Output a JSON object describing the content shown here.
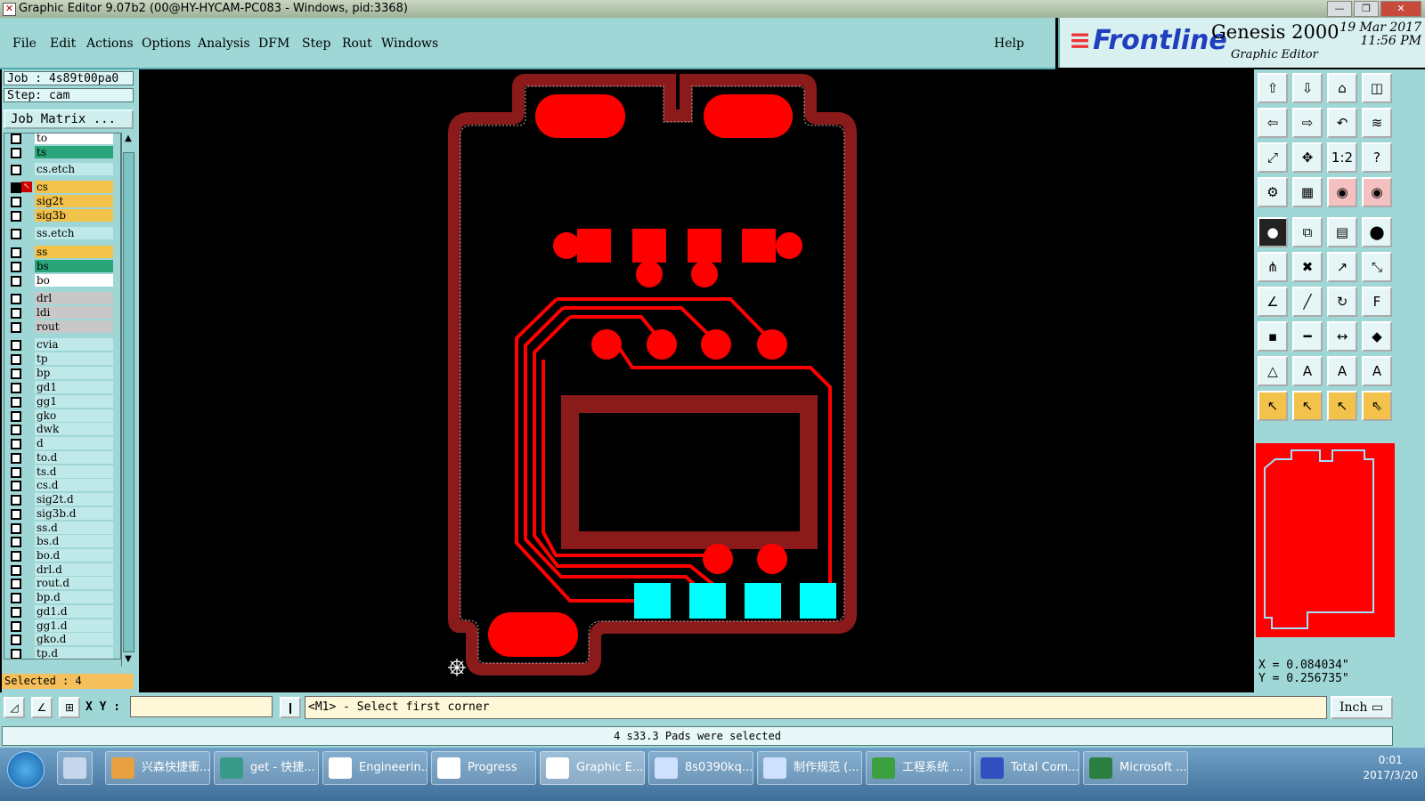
{
  "window": {
    "title": "Graphic Editor 9.07b2 (00@HY-HYCAM-PC083 - Windows, pid:3368)"
  },
  "menu": {
    "file": "File",
    "edit": "Edit",
    "actions": "Actions",
    "options": "Options",
    "analysis": "Analysis",
    "dfm": "DFM",
    "step": "Step",
    "rout": "Rout",
    "windows": "Windows",
    "help": "Help"
  },
  "brand": {
    "logo": "Frontline",
    "product": "Genesis 2000",
    "subtitle": "Graphic Editor",
    "date": "19 Mar 2017",
    "time": "11:56 PM"
  },
  "job": {
    "job_label": "Job : 4s89t00pa0",
    "step_label": "Step: cam",
    "matrix_button": "Job Matrix ..."
  },
  "layers": [
    {
      "name": "to",
      "color": "#ffffff"
    },
    {
      "name": "ts",
      "color": "#2aa57a"
    },
    {
      "name": "cs.etch",
      "color": "#bfe8e8"
    },
    {
      "name": "cs",
      "color": "#f3c24a"
    },
    {
      "name": "sig2t",
      "color": "#f3c24a"
    },
    {
      "name": "sig3b",
      "color": "#f3c24a"
    },
    {
      "name": "ss.etch",
      "color": "#bfe8e8"
    },
    {
      "name": "ss",
      "color": "#f3c24a"
    },
    {
      "name": "bs",
      "color": "#2aa57a"
    },
    {
      "name": "bo",
      "color": "#ffffff"
    },
    {
      "name": "drl",
      "color": "#c8c8c8"
    },
    {
      "name": "ldi",
      "color": "#c8c8c8"
    },
    {
      "name": "rout",
      "color": "#c8c8c8"
    },
    {
      "name": "cvia",
      "color": "#bfe8e8"
    },
    {
      "name": "tp",
      "color": "#bfe8e8"
    },
    {
      "name": "bp",
      "color": "#bfe8e8"
    },
    {
      "name": "gd1",
      "color": "#bfe8e8"
    },
    {
      "name": "gg1",
      "color": "#bfe8e8"
    },
    {
      "name": "gko",
      "color": "#bfe8e8"
    },
    {
      "name": "dwk",
      "color": "#bfe8e8"
    },
    {
      "name": "d",
      "color": "#bfe8e8"
    },
    {
      "name": "to.d",
      "color": "#bfe8e8"
    },
    {
      "name": "ts.d",
      "color": "#bfe8e8"
    },
    {
      "name": "cs.d",
      "color": "#bfe8e8"
    },
    {
      "name": "sig2t.d",
      "color": "#bfe8e8"
    },
    {
      "name": "sig3b.d",
      "color": "#bfe8e8"
    },
    {
      "name": "ss.d",
      "color": "#bfe8e8"
    },
    {
      "name": "bs.d",
      "color": "#bfe8e8"
    },
    {
      "name": "bo.d",
      "color": "#bfe8e8"
    },
    {
      "name": "drl.d",
      "color": "#bfe8e8"
    },
    {
      "name": "rout.d",
      "color": "#bfe8e8"
    },
    {
      "name": "bp.d",
      "color": "#bfe8e8"
    },
    {
      "name": "gd1.d",
      "color": "#bfe8e8"
    },
    {
      "name": "gg1.d",
      "color": "#bfe8e8"
    },
    {
      "name": "gko.d",
      "color": "#bfe8e8"
    },
    {
      "name": "tp.d",
      "color": "#bfe8e8"
    }
  ],
  "selected_label": "Selected : 4",
  "coords": {
    "x": "X = 0.084034\"",
    "y": "Y = 0.256735\""
  },
  "cmd": {
    "xy_label": "X Y :",
    "xy_value": "",
    "prompt": "<M1> - Select first corner",
    "unit": "Inch"
  },
  "status": "4 s33.3 Pads were selected",
  "taskbar": {
    "items": [
      {
        "label": "兴森快捷衝...",
        "icon_color": "#e8a040"
      },
      {
        "label": "get - 快捷...",
        "icon_color": "#3a9a8a"
      },
      {
        "label": "Engineerin...",
        "icon_color": "#ffffff"
      },
      {
        "label": "Progress",
        "icon_color": "#ffffff"
      },
      {
        "label": "Graphic E...",
        "icon_color": "#ffffff"
      },
      {
        "label": "8s0390kq...",
        "icon_color": "#d0e0ff"
      },
      {
        "label": "制作规范 (...",
        "icon_color": "#d0e0ff"
      },
      {
        "label": "工程系统   ...",
        "icon_color": "#3aa040"
      },
      {
        "label": "Total Com...",
        "icon_color": "#3050c0"
      },
      {
        "label": "Microsoft ...",
        "icon_color": "#2a8040"
      }
    ],
    "clock_time": "0:01",
    "clock_date": "2017/3/20"
  },
  "colors": {
    "panel": "#9fd7d7",
    "copper": "#ff0000",
    "copper_dark": "#8b1a1a",
    "selected_pad": "#00ffff"
  }
}
